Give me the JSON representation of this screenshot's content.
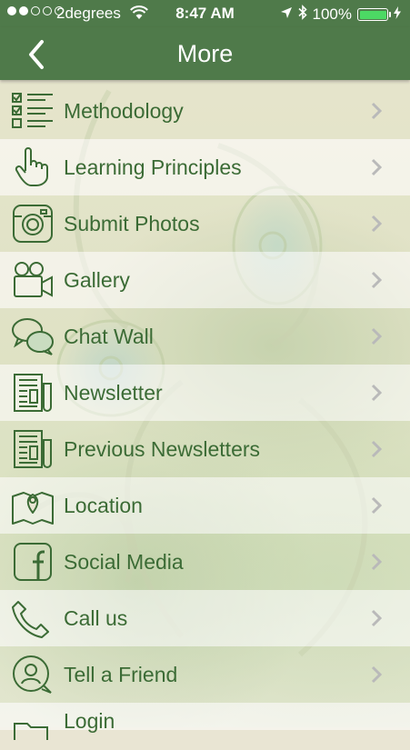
{
  "status_bar": {
    "carrier": "2degrees",
    "time": "8:47 AM",
    "battery_percent": "100%",
    "signal_bars_filled": 2,
    "signal_bars_total": 5,
    "battery_color": "#4cd964"
  },
  "nav": {
    "title": "More",
    "back_icon": "chevron-left-icon",
    "bar_color": "#4f7a4a"
  },
  "menu": {
    "label_color": "#3b6b35",
    "items": [
      {
        "label": "Methodology",
        "icon": "checklist-icon"
      },
      {
        "label": "Learning Principles",
        "icon": "pointing-hand-icon"
      },
      {
        "label": "Submit Photos",
        "icon": "camera-icon"
      },
      {
        "label": "Gallery",
        "icon": "video-camera-icon"
      },
      {
        "label": "Chat Wall",
        "icon": "chat-bubbles-icon"
      },
      {
        "label": "Newsletter",
        "icon": "newspaper-icon"
      },
      {
        "label": "Previous Newsletters",
        "icon": "newspaper-icon"
      },
      {
        "label": "Location",
        "icon": "map-pin-icon"
      },
      {
        "label": "Social Media",
        "icon": "facebook-icon"
      },
      {
        "label": "Call us",
        "icon": "phone-icon"
      },
      {
        "label": "Tell a Friend",
        "icon": "user-circle-icon"
      },
      {
        "label": "Login",
        "icon": "folder-icon"
      }
    ]
  }
}
